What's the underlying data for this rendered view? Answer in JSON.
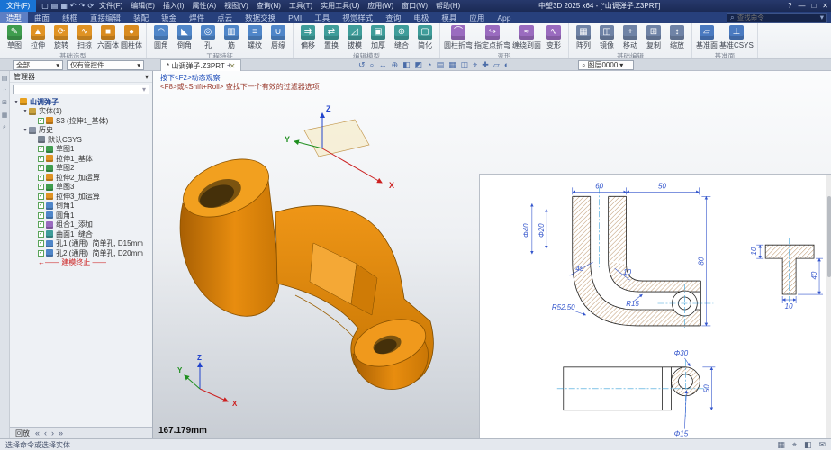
{
  "titlebar": {
    "file_button": "文件(F)",
    "qat_icons": [
      {
        "g": "▢",
        "n": "new-file-icon"
      },
      {
        "g": "▤",
        "n": "open-file-icon"
      },
      {
        "g": "▦",
        "n": "save-icon"
      },
      {
        "g": "↶",
        "n": "undo-icon"
      },
      {
        "g": "↷",
        "n": "redo-icon"
      },
      {
        "g": "⟳",
        "n": "regen-icon"
      }
    ],
    "menus": [
      "文件(F)",
      "编辑(E)",
      "插入(I)",
      "属性(A)",
      "视图(V)",
      "查询(N)",
      "工具(T)",
      "实用工具(U)",
      "应用(W)",
      "窗口(W)",
      "帮助(H)"
    ],
    "title": "中望3D 2025 x64 - [*山调弹子.Z3PRT]",
    "window_controls": [
      {
        "g": "?",
        "n": "help-icon"
      },
      {
        "g": "—",
        "n": "minimize-icon"
      },
      {
        "g": "□",
        "n": "maximize-icon"
      },
      {
        "g": "✕",
        "n": "close-icon"
      }
    ]
  },
  "tabbar": {
    "tabs": [
      {
        "label": "造型",
        "active": true
      },
      {
        "label": "曲面",
        "active": false
      },
      {
        "label": "线框",
        "active": false
      },
      {
        "label": "直接编辑",
        "active": false
      },
      {
        "label": "装配",
        "active": false
      },
      {
        "label": "钣金",
        "active": false
      },
      {
        "label": "焊件",
        "active": false
      },
      {
        "label": "点云",
        "active": false
      },
      {
        "label": "数据交换",
        "active": false
      },
      {
        "label": "PMI",
        "active": false
      },
      {
        "label": "工具",
        "active": false
      },
      {
        "label": "视觉样式",
        "active": false
      },
      {
        "label": "查询",
        "active": false
      },
      {
        "label": "电极",
        "active": false
      },
      {
        "label": "模具",
        "active": false
      },
      {
        "label": "应用",
        "active": false
      },
      {
        "label": "App",
        "active": false
      }
    ],
    "search_placeholder": "查找命令"
  },
  "ribbon": {
    "groups": [
      {
        "name": "基础造型",
        "items": [
          {
            "t": "草图",
            "g": "✎",
            "c": "#3f9d4e",
            "n": "sketch"
          },
          {
            "t": "拉伸",
            "g": "▲",
            "c": "#e09324",
            "n": "extrude"
          },
          {
            "t": "旋转",
            "g": "⟳",
            "c": "#e09324",
            "n": "revolve"
          },
          {
            "t": "扫掠",
            "g": "∿",
            "c": "#e09324",
            "n": "sweep"
          },
          {
            "t": "六面体",
            "g": "■",
            "c": "#d98b1f",
            "n": "box"
          },
          {
            "t": "圆柱体",
            "g": "●",
            "c": "#d98b1f",
            "n": "cylinder"
          }
        ]
      },
      {
        "name": "工程特征",
        "items": [
          {
            "t": "圆角",
            "g": "◠",
            "c": "#4f86c9",
            "n": "fillet"
          },
          {
            "t": "倒角",
            "g": "◣",
            "c": "#4f86c9",
            "n": "chamfer"
          },
          {
            "t": "孔",
            "g": "◎",
            "c": "#4f86c9",
            "n": "hole"
          },
          {
            "t": "筋",
            "g": "▥",
            "c": "#4f86c9",
            "n": "rib"
          },
          {
            "t": "螺纹",
            "g": "≡",
            "c": "#4f86c9",
            "n": "thread"
          },
          {
            "t": "唇缘",
            "g": "∪",
            "c": "#4f86c9",
            "n": "lip"
          }
        ]
      },
      {
        "name": "编辑模型",
        "items": [
          {
            "t": "偏移",
            "g": "⇉",
            "c": "#3f9d9a",
            "n": "offset"
          },
          {
            "t": "置换",
            "g": "⇄",
            "c": "#3f9d9a",
            "n": "replace"
          },
          {
            "t": "拔模",
            "g": "◿",
            "c": "#3f9d9a",
            "n": "draft"
          },
          {
            "t": "加厚",
            "g": "▣",
            "c": "#3f9d9a",
            "n": "thicken"
          },
          {
            "t": "缝合",
            "g": "⊕",
            "c": "#3f9d9a",
            "n": "sew"
          },
          {
            "t": "简化",
            "g": "▢",
            "c": "#3f9d9a",
            "n": "simplify"
          }
        ]
      },
      {
        "name": "变形",
        "items": [
          {
            "t": "圆柱折弯",
            "g": "⌒",
            "c": "#9a6bbf",
            "n": "cylindrical-bend"
          },
          {
            "t": "指定点折弯",
            "g": "↪",
            "c": "#9a6bbf",
            "n": "bend-by-point"
          },
          {
            "t": "缠绕到面",
            "g": "≈",
            "c": "#9a6bbf",
            "n": "wrap-to-face"
          },
          {
            "t": "变形",
            "g": "∿",
            "c": "#9a6bbf",
            "n": "morph"
          }
        ]
      },
      {
        "name": "基础编辑",
        "items": [
          {
            "t": "阵列",
            "g": "▦",
            "c": "#6f83a6",
            "n": "pattern"
          },
          {
            "t": "镜像",
            "g": "◫",
            "c": "#6f83a6",
            "n": "mirror"
          },
          {
            "t": "移动",
            "g": "+",
            "c": "#6f83a6",
            "n": "move"
          },
          {
            "t": "复制",
            "g": "⊞",
            "c": "#6f83a6",
            "n": "copy"
          },
          {
            "t": "缩放",
            "g": "↕",
            "c": "#6f83a6",
            "n": "scale"
          }
        ]
      },
      {
        "name": "基准面",
        "items": [
          {
            "t": "基准面",
            "g": "▱",
            "c": "#4a7ac0",
            "n": "datum-plane"
          },
          {
            "t": "基准CSYS",
            "g": "⊥",
            "c": "#4a7ac0",
            "n": "datum-csys"
          }
        ]
      }
    ]
  },
  "subbar": {
    "filter_all": "全部",
    "filter_scope": "仅有管控件"
  },
  "doc_tab": {
    "label": "* 山调弹子.Z3PRT",
    "close": "✕",
    "new_tab": "+"
  },
  "manager": {
    "header": "管理器",
    "header_icon": "▾",
    "side_icons": [
      {
        "g": "▤",
        "n": "manager-tab-icon"
      },
      {
        "g": "◔",
        "n": "history-tab-icon"
      },
      {
        "g": "⊞",
        "n": "assembly-tab-icon"
      },
      {
        "g": "▦",
        "n": "layer-tab-icon"
      },
      {
        "g": "⌕",
        "n": "find-tab-icon"
      }
    ],
    "tree": [
      {
        "t": "山调弹子",
        "lvl": 0,
        "exp": true,
        "c": "#e8a11f",
        "n": "tree-root"
      },
      {
        "t": "实体(1)",
        "lvl": 1,
        "exp": true,
        "c": "#c9a23f",
        "n": "solids-folder"
      },
      {
        "t": "S3 (拉伸1_基体)",
        "lvl": 2,
        "chk": true,
        "c": "#d98b1f",
        "n": "solid-item"
      },
      {
        "t": "历史",
        "lvl": 1,
        "exp": true,
        "c": "#8a94a6",
        "n": "history-folder"
      },
      {
        "t": "默认CSYS",
        "lvl": 2,
        "c": "#7a8594",
        "n": "csys-item"
      },
      {
        "t": "草图1",
        "lvl": 2,
        "chk": true,
        "c": "#3f9d4e",
        "n": "sketch-item"
      },
      {
        "t": "拉伸1_基体",
        "lvl": 2,
        "chk": true,
        "c": "#e09324",
        "n": "feature-item"
      },
      {
        "t": "草图2",
        "lvl": 2,
        "chk": true,
        "c": "#3f9d4e",
        "n": "sketch-item"
      },
      {
        "t": "拉伸2_加运算",
        "lvl": 2,
        "chk": true,
        "c": "#e09324",
        "n": "feature-item"
      },
      {
        "t": "草图3",
        "lvl": 2,
        "chk": true,
        "c": "#3f9d4e",
        "n": "sketch-item"
      },
      {
        "t": "拉伸3_加运算",
        "lvl": 2,
        "chk": true,
        "c": "#e09324",
        "n": "feature-item"
      },
      {
        "t": "倒角1",
        "lvl": 2,
        "chk": true,
        "c": "#4f86c9",
        "n": "feature-item"
      },
      {
        "t": "圆角1",
        "lvl": 2,
        "chk": true,
        "c": "#4f86c9",
        "n": "feature-item"
      },
      {
        "t": "组合1_添加",
        "lvl": 2,
        "chk": true,
        "c": "#9a6bbf",
        "n": "feature-item"
      },
      {
        "t": "曲面1_缝合",
        "lvl": 2,
        "chk": true,
        "c": "#3f9d9a",
        "n": "feature-item"
      },
      {
        "t": "孔1 (通用)_简单孔, D15mm",
        "lvl": 2,
        "chk": true,
        "c": "#4f86c9",
        "n": "hole-item"
      },
      {
        "t": "孔2 (通用)_简单孔, D20mm",
        "lvl": 2,
        "chk": true,
        "c": "#4f86c9",
        "n": "hole-item"
      },
      {
        "t": "←—— 建模终止 ——",
        "lvl": 2,
        "fg": "#cc2222",
        "n": "history-stop"
      }
    ]
  },
  "playback": {
    "label": "回放",
    "icons": [
      {
        "g": "«",
        "n": "play-first-icon"
      },
      {
        "g": "‹",
        "n": "play-back-icon"
      },
      {
        "g": "›",
        "n": "play-forward-icon"
      },
      {
        "g": "»",
        "n": "play-last-icon"
      }
    ]
  },
  "viewport": {
    "prompt1": "按下<F2>动态观察",
    "prompt2": "<F8>或<Shift+Roll> 查找下一个有效的过滤器选项",
    "measure": "167.179mm",
    "layer_combo": {
      "glyph": "⌕",
      "label": "图层0000"
    },
    "da_icons": [
      {
        "g": "↺",
        "n": "orbit-icon"
      },
      {
        "g": "⌕",
        "n": "zoom-icon"
      },
      {
        "g": "↔",
        "n": "pan-icon"
      },
      {
        "g": "⊕",
        "n": "zoom-fit-icon"
      },
      {
        "g": "◧",
        "n": "shade-mode-icon"
      },
      {
        "g": "◩",
        "n": "wireframe-icon"
      },
      {
        "g": "◔",
        "n": "perspective-icon"
      },
      {
        "g": "▤",
        "n": "section-view-icon"
      },
      {
        "g": "▦",
        "n": "grid-icon"
      },
      {
        "g": "◫",
        "n": "multi-view-icon"
      },
      {
        "g": "⌖",
        "n": "target-point-icon"
      },
      {
        "g": "✚",
        "n": "add-view-icon"
      },
      {
        "g": "▱",
        "n": "plane-display-icon"
      },
      {
        "g": "◐",
        "n": "render-mode-icon"
      }
    ],
    "triad": {
      "x": "X",
      "y": "Y",
      "z": "Z"
    }
  },
  "drawing": {
    "dim_60": "60",
    "dim_50": "50",
    "dim_phi40": "Φ40",
    "dim_phi20": "Φ20",
    "dim_45": "45",
    "dim_10a": "10",
    "dim_80": "80",
    "dim_r52": "R52.50",
    "dim_r15": "R15",
    "dim_10b": "10",
    "dim_40": "40",
    "dim_10c": "10",
    "dim_phi30": "Φ30",
    "dim_50b": "50",
    "dim_phi15": "Φ15"
  },
  "statusbar": {
    "message": "选择命令或选择实体",
    "icons": [
      {
        "g": "▦",
        "n": "grid-toggle-icon"
      },
      {
        "g": "⌖",
        "n": "pick-filter-icon"
      },
      {
        "g": "◧",
        "n": "display-toggle-icon"
      },
      {
        "g": "✉",
        "n": "message-icon"
      }
    ]
  }
}
